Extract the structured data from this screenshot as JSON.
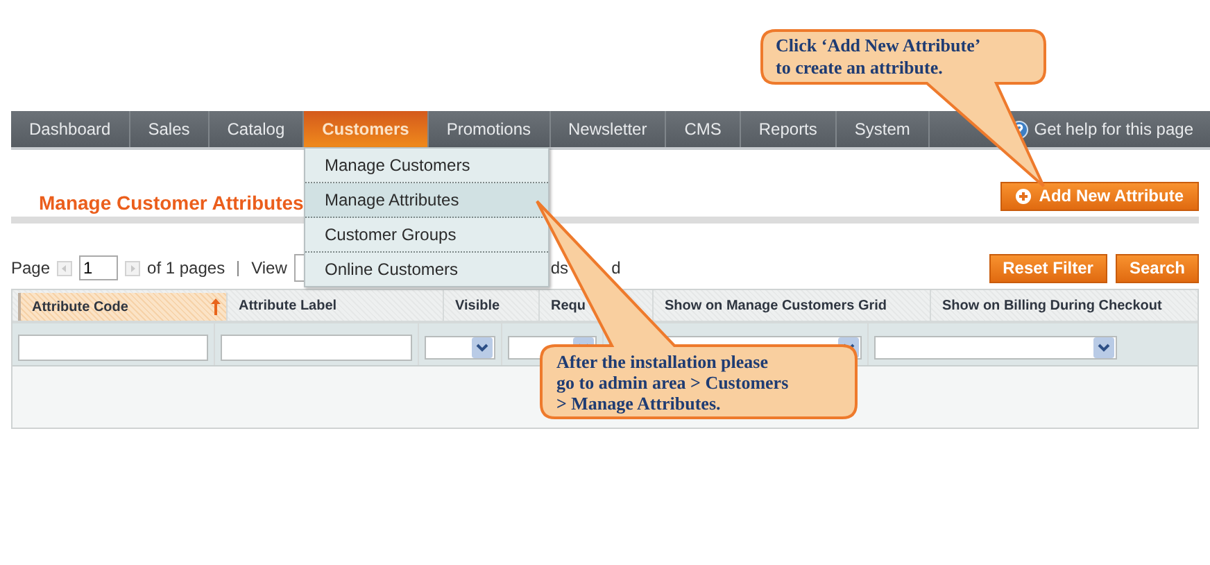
{
  "nav": {
    "items": [
      {
        "label": "Dashboard",
        "selected": false
      },
      {
        "label": "Sales",
        "selected": false
      },
      {
        "label": "Catalog",
        "selected": false
      },
      {
        "label": "Customers",
        "selected": true
      },
      {
        "label": "Promotions",
        "selected": false
      },
      {
        "label": "Newsletter",
        "selected": false
      },
      {
        "label": "CMS",
        "selected": false
      },
      {
        "label": "Reports",
        "selected": false
      },
      {
        "label": "System",
        "selected": false
      }
    ],
    "help": "Get help for this page"
  },
  "menu": {
    "items": [
      {
        "label": "Manage Customers",
        "selected": false
      },
      {
        "label": "Manage Attributes",
        "selected": true
      },
      {
        "label": "Customer Groups",
        "selected": false
      },
      {
        "label": "Online Customers",
        "selected": false
      }
    ]
  },
  "page": {
    "title": "Manage Customer Attributes",
    "add_button": "Add New Attribute"
  },
  "pager": {
    "page_label": "Page",
    "page_value": "1",
    "pages_text": "of 1 pages",
    "view_label": "View",
    "records_part_1": "ds",
    "records_part_2": "d"
  },
  "actions": [
    "Reset Filter",
    "Search"
  ],
  "table": {
    "columns": [
      {
        "label": "Attribute Code",
        "sorted": true,
        "kind": "text"
      },
      {
        "label": "Attribute Label",
        "sorted": false,
        "kind": "text"
      },
      {
        "label": "Visible",
        "sorted": false,
        "kind": "select"
      },
      {
        "label": "Requ",
        "sorted": false,
        "kind": "select"
      },
      {
        "label": "Show on Manage Customers Grid",
        "sorted": false,
        "kind": "select"
      },
      {
        "label": "Show on Billing During Checkout",
        "sorted": false,
        "kind": "select"
      }
    ]
  },
  "callouts": [
    {
      "lines": [
        "Click ‘Add New Attribute’",
        "to create an attribute."
      ],
      "kind": "top"
    },
    {
      "lines": [
        "After the installation please",
        "go to admin area > Customers",
        "> Manage Attributes."
      ],
      "kind": "bottom"
    }
  ]
}
